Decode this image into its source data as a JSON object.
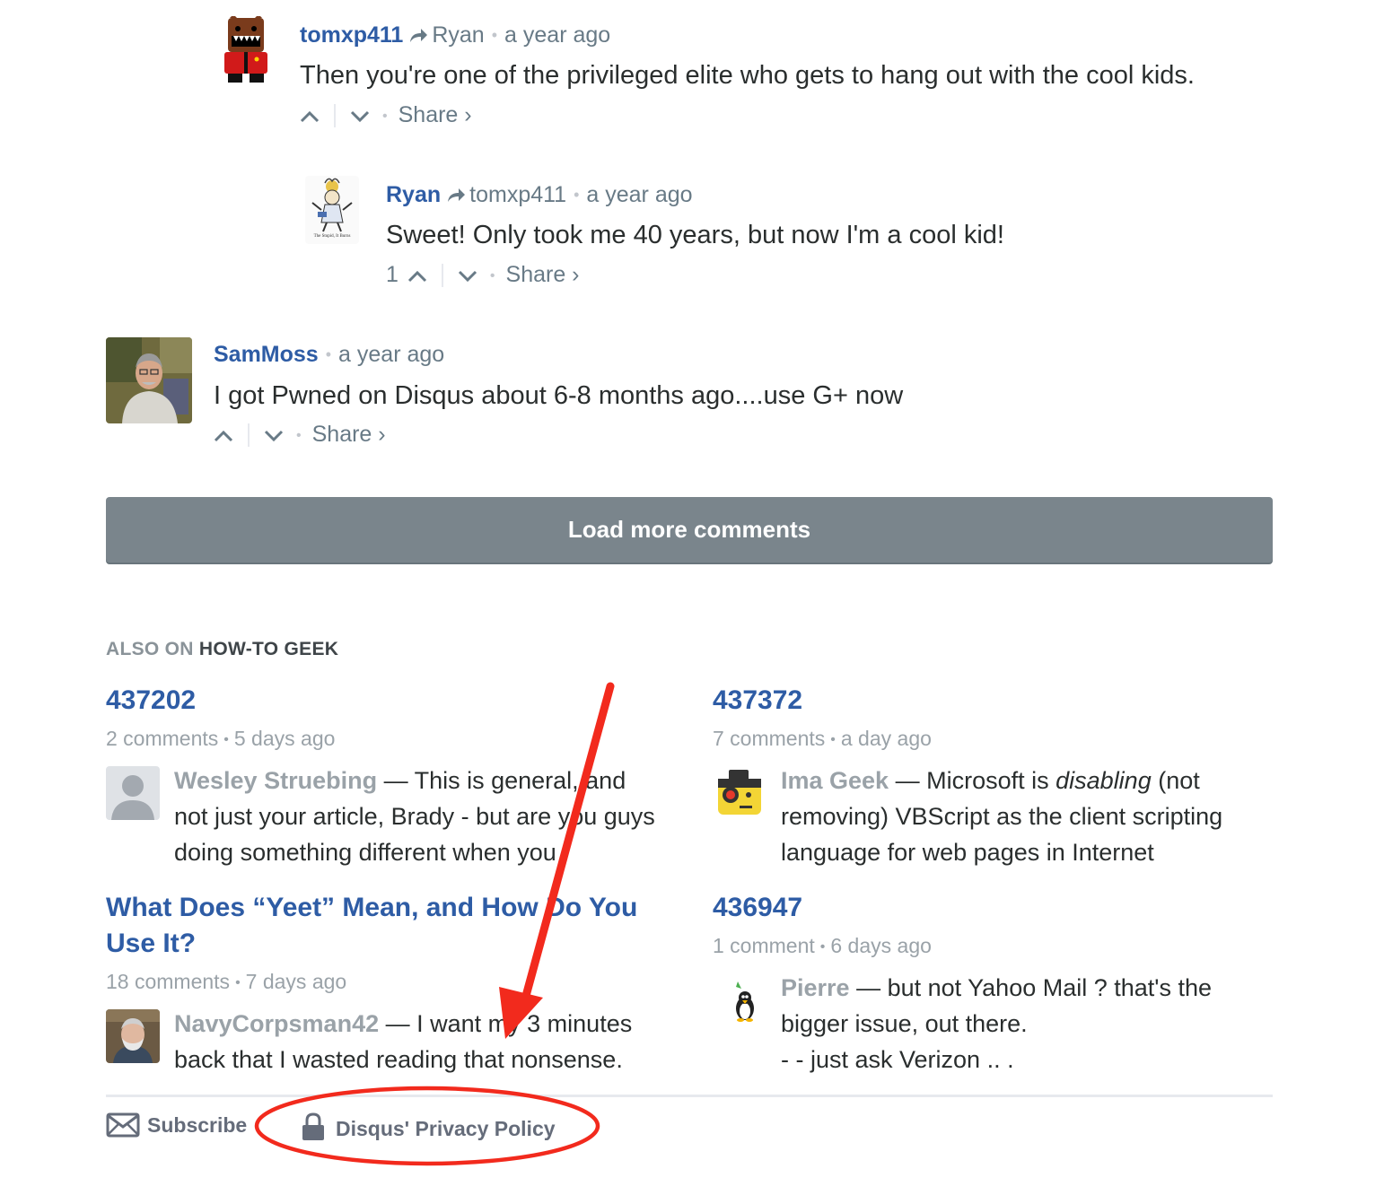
{
  "comments": [
    {
      "author": "tomxp411",
      "reply_to": "Ryan",
      "time": "a year ago",
      "text": "Then you're one of the privileged elite who gets to hang out with the cool kids.",
      "votes": "",
      "share_label": "Share ›"
    },
    {
      "author": "Ryan",
      "reply_to": "tomxp411",
      "time": "a year ago",
      "text": "Sweet! Only took me 40 years, but now I'm a cool kid!",
      "votes": "1",
      "share_label": "Share ›",
      "avatar_caption": "The Stupid, It Burns"
    },
    {
      "author": "SamMoss",
      "reply_to": "",
      "time": "a year ago",
      "text": "I got Pwned on Disqus about 6-8 months ago....use G+ now",
      "votes": "",
      "share_label": "Share ›"
    }
  ],
  "load_more_label": "Load more comments",
  "also_on": {
    "prefix": "ALSO ON",
    "site": "HOW-TO GEEK"
  },
  "discussions": [
    {
      "title": "437202",
      "comments": "2 comments",
      "time": "5 days ago",
      "commenter": "Wesley Struebing",
      "excerpt": "This is general, and not just your article, Brady - but are you guys doing something different when you"
    },
    {
      "title": "437372",
      "comments": "7 comments",
      "time": "a day ago",
      "commenter": "Ima Geek",
      "excerpt_before": "Microsoft is",
      "excerpt_em": "disabling",
      "excerpt_after": "(not removing) VBScript as the client scripting language for web pages in Internet"
    },
    {
      "title": "What Does “Yeet” Mean, and How Do You Use It?",
      "comments": "18 comments",
      "time": "7 days ago",
      "commenter": "NavyCorpsman42",
      "excerpt": "I want my 3 minutes back that I wasted reading that nonsense."
    },
    {
      "title": "436947",
      "comments": "1 comment",
      "time": "6 days ago",
      "commenter": "Pierre",
      "excerpt": "but not Yahoo Mail ? that's the bigger issue, out there.",
      "excerpt_line2": "- - just ask Verizon .. ."
    }
  ],
  "footer": {
    "subscribe": "Subscribe",
    "privacy": "Disqus' Privacy Policy"
  },
  "colors": {
    "link": "#2e5ca5",
    "muted": "#687a86",
    "button": "#7a858c",
    "annotation": "#f22a1d"
  },
  "icons": [
    "reply-arrow-icon",
    "upvote-icon",
    "downvote-icon",
    "mail-icon",
    "lock-icon"
  ]
}
